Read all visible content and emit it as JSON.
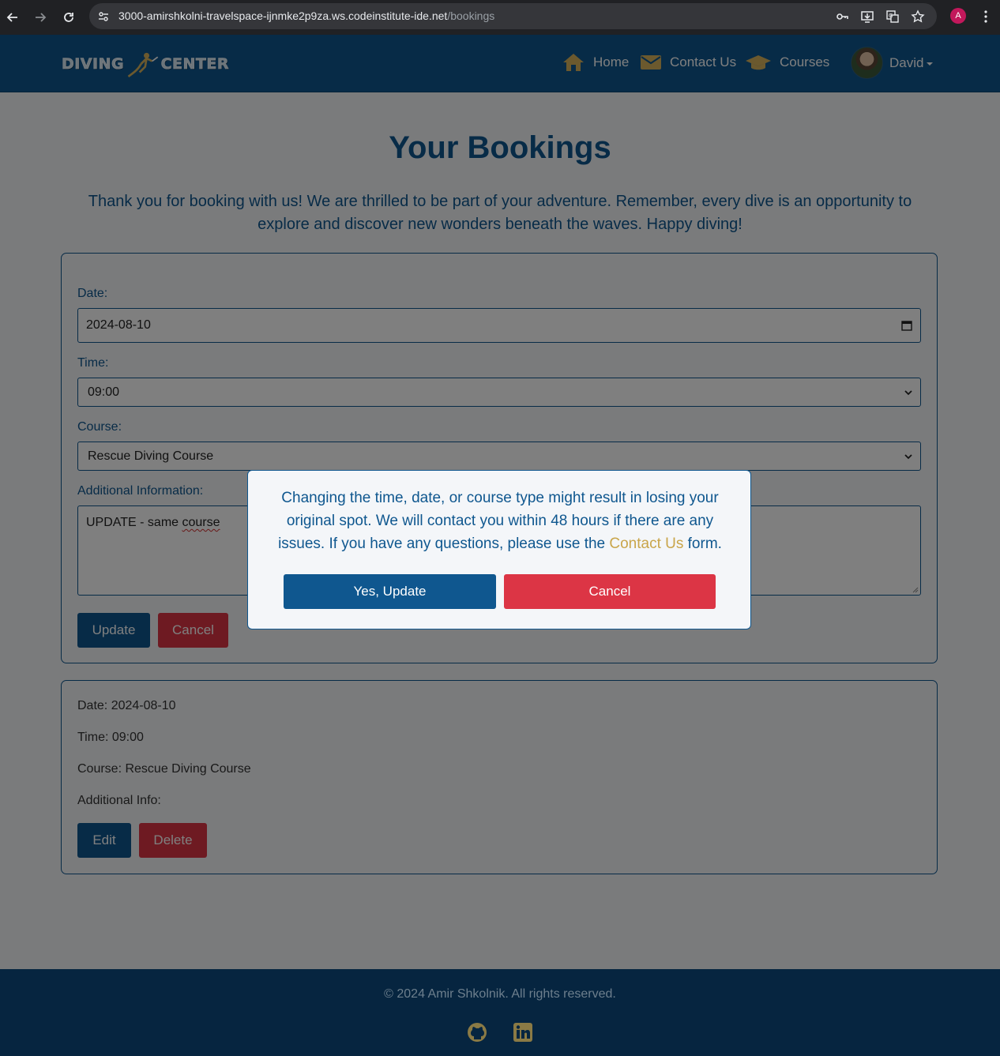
{
  "browser": {
    "url_host": "3000-amirshkolni-travelspace-ijnmke2p9za.ws.codeinstitute-ide.net",
    "url_path": "/bookings",
    "profile_initial": "A"
  },
  "navbar": {
    "logo_left": "DIVING",
    "logo_right": "CENTER",
    "items": [
      {
        "label": "Home",
        "icon": "home-icon"
      },
      {
        "label": "Contact Us",
        "icon": "envelope-icon"
      },
      {
        "label": "Courses",
        "icon": "graduation-cap-icon"
      }
    ],
    "user_name": "David"
  },
  "page": {
    "title": "Your Bookings",
    "intro": "Thank you for booking with us! We are thrilled to be part of your adventure. Remember, every dive is an opportunity to explore and discover new wonders beneath the waves. Happy diving!"
  },
  "form": {
    "date_label": "Date:",
    "date_value": "2024-08-10",
    "time_label": "Time:",
    "time_value": "09:00",
    "course_label": "Course:",
    "course_value": "Rescue Diving Course",
    "info_label": "Additional Information:",
    "info_value_prefix": "UPDATE - same ",
    "info_value_misspelled": "course",
    "update_button": "Update",
    "cancel_button": "Cancel"
  },
  "booking": {
    "date": "Date: 2024-08-10",
    "time": "Time: 09:00",
    "course": "Course: Rescue Diving Course",
    "info": "Additional Info:",
    "edit_button": "Edit",
    "delete_button": "Delete"
  },
  "modal": {
    "text_before": "Changing the time, date, or course type might result in losing your original spot. We will contact you within 48 hours if there are any issues. If you have any questions, please use the ",
    "link_text": "Contact Us",
    "text_after": " form.",
    "confirm_button": "Yes, Update",
    "cancel_button": "Cancel"
  },
  "footer": {
    "copyright": "© 2024 Amir Shkolnik. All rights reserved.",
    "social": [
      "github-icon",
      "linkedin-icon"
    ]
  },
  "colors": {
    "primary": "#0f578f",
    "danger": "#dc3545",
    "accent_gold": "#c9a54a",
    "footer": "#062540"
  }
}
